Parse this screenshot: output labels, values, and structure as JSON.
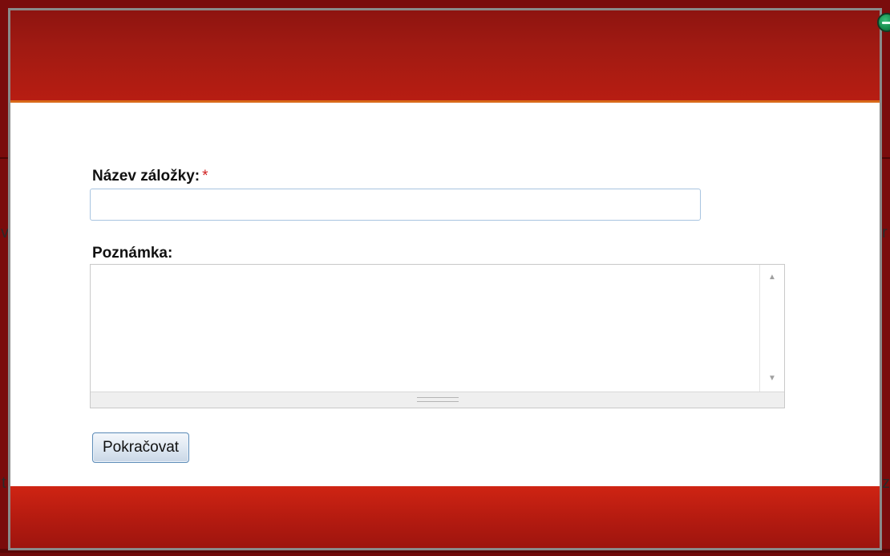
{
  "dialog": {
    "name_label": "Název záložky:",
    "required_marker": "*",
    "name_value": "",
    "note_label": "Poznámka:",
    "note_value": "",
    "continue_label": "Pokračovat"
  },
  "icons": {
    "close": "close-icon",
    "scroll_up": "scroll-up-arrow-icon",
    "scroll_down": "scroll-down-arrow-icon",
    "resize": "resize-grip-icon"
  },
  "colors": {
    "header_red": "#a01a12",
    "footer_red": "#cf2413",
    "header_border_orange": "#d8691a",
    "required_red": "#d02020",
    "button_border_blue": "#5f8db8",
    "close_green": "#148a4b"
  }
}
